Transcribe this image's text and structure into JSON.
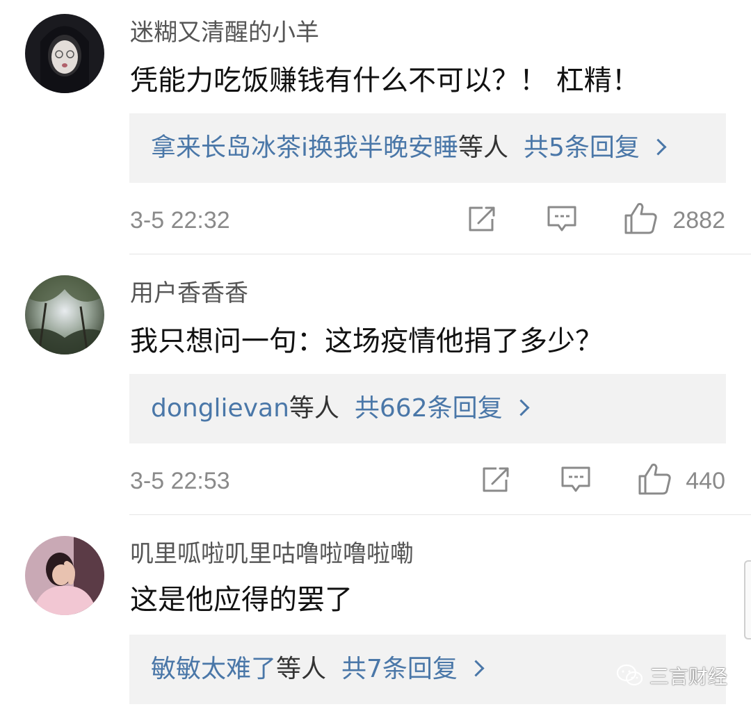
{
  "comments": [
    {
      "username": "迷糊又清醒的小羊",
      "content": "凭能力吃饭赚钱有什么不可以？！ 杠精！",
      "reply_users": "拿来长岛冰茶i换我半晚安睡",
      "reply_suffix": "等人",
      "reply_count": "共5条回复",
      "time": "3-5 22:32",
      "likes": "2882"
    },
    {
      "username": "用户香香香",
      "content": "我只想问一句：这场疫情他捐了多少？",
      "reply_users": "donglievan",
      "reply_suffix": "等人",
      "reply_count": "共662条回复",
      "time": "3-5 22:53",
      "likes": "440"
    },
    {
      "username": "叽里呱啦叽里咕噜啦噜啦嘞",
      "content": "这是他应得的罢了",
      "reply_users": "敏敏太难了",
      "reply_suffix": "等人",
      "reply_count": "共7条回复"
    }
  ],
  "watermark": {
    "text": "三言财经",
    "icon": "wechat-icon"
  },
  "icons": {
    "share": "share-icon",
    "comment": "comment-icon",
    "like": "thumbs-up-icon"
  },
  "colors": {
    "link": "#4a77a8",
    "username": "#555555",
    "meta": "#8a8a8a",
    "reply_box_bg": "#f2f2f2"
  }
}
